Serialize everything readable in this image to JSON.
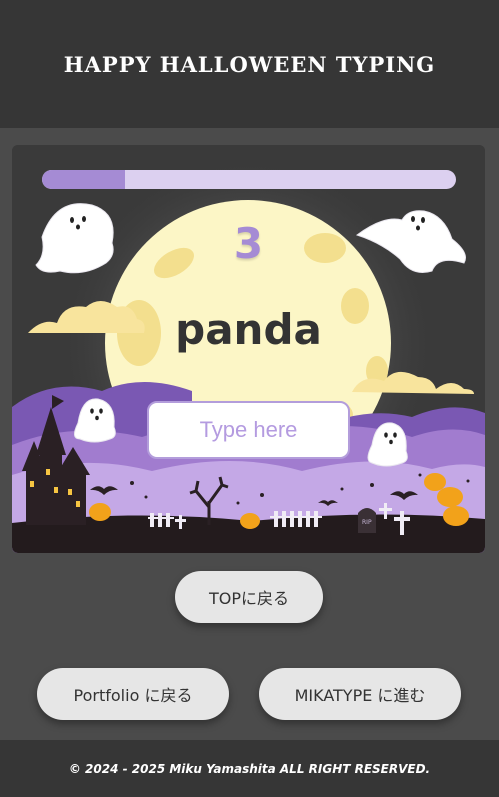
{
  "header": {
    "title": "HAPPY HALLOWEEN TYPING"
  },
  "game": {
    "progress": 0.2,
    "countdown": "3",
    "word": "panda",
    "input": {
      "placeholder": "Type here",
      "value": ""
    }
  },
  "buttons": {
    "top": "TOPに戻る",
    "portfolio": "Portfolio に戻る",
    "mikatype": "MIKATYPE に進む"
  },
  "footer": {
    "copyright": "© 2024 - 2025 Miku Yamashita ALL RIGHT RESERVED."
  },
  "colors": {
    "accent": "#a58bd4",
    "progress_track": "#dcd0f0",
    "moon": "#fcf6c6",
    "header_bg": "#363636",
    "page_bg": "#4b4b4b"
  },
  "icons": [
    "ghost-icon",
    "moon-icon",
    "cloud-icon",
    "haunted-castle-icon",
    "pumpkin-icon",
    "bat-icon",
    "tombstone-icon",
    "cross-icon",
    "star-icon",
    "bare-tree-icon"
  ]
}
